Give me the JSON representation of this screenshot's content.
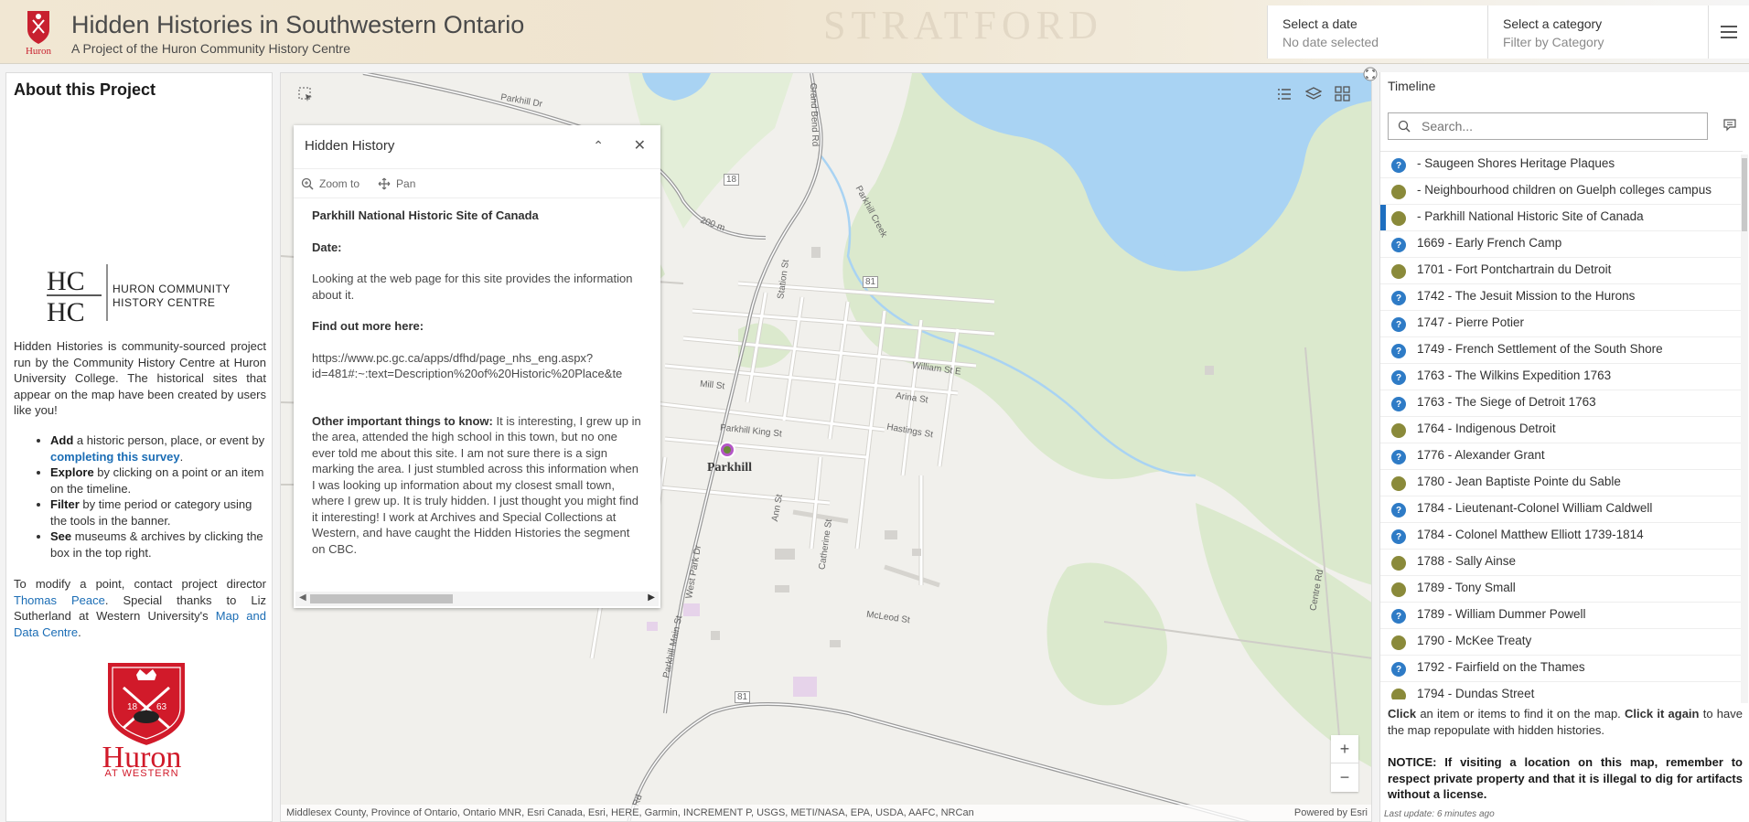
{
  "header": {
    "title": "Hidden Histories in Southwestern Ontario",
    "subtitle": "A Project of the Huron Community History Centre",
    "logo_text": "Huron",
    "date_filter": {
      "label": "Select a date",
      "value": "No date selected"
    },
    "category_filter": {
      "label": "Select a category",
      "value": "Filter by Category"
    }
  },
  "about": {
    "title": "About this Project",
    "hchc_mark": "HC",
    "hchc_name_line1": "HURON COMMUNITY",
    "hchc_name_line2": "HISTORY CENTRE",
    "intro": "Hidden Histories is community-sourced project run by the Community History Centre at Huron University College. The historical sites that appear on the map have been created by users like you!",
    "bullets": [
      {
        "strong": "Add",
        "pre": " a historic person, place, or event by ",
        "link": "completing this survey",
        "post": "."
      },
      {
        "strong": "Explore",
        "pre": " by clicking on a point or an item on the timeline.",
        "link": "",
        "post": ""
      },
      {
        "strong": "Filter",
        "pre": " by time period or category using the tools in the banner.",
        "link": "",
        "post": ""
      },
      {
        "strong": "See",
        "pre": " museums & archives by clicking the box in the top right.",
        "link": "",
        "post": ""
      }
    ],
    "modify_pre": "To modify a point, contact project director ",
    "modify_link1": "Thomas Peace",
    "modify_mid": ". Special thanks to Liz Sutherland at Western University's ",
    "modify_link2": "Map and Data Centre",
    "modify_post": ".",
    "huron_word": "Huron",
    "huron_sub": "AT WESTERN",
    "crest_left": "18",
    "crest_right": "63"
  },
  "map": {
    "town": "Parkhill",
    "streets": [
      "Parkhill Dr",
      "Mill St",
      "Parkhill King St",
      "Station St",
      "William St E",
      "Arina St",
      "Hastings St",
      "Ann St",
      "Catherine St",
      "McLeod St",
      "West Park Dr",
      "Parkhill Main St",
      "Centre Rd",
      "Grand Bend Rd",
      "Parkhill Creek",
      "200 m",
      "18",
      "81",
      "81",
      "Rd"
    ],
    "attribution": "Middlesex County, Province of Ontario, Ontario MNR, Esri Canada, Esri, HERE, Garmin, INCREMENT P, USGS, METI/NASA, EPA, USDA, AAFC, NRCan",
    "powered_by": "Powered by Esri",
    "zoom_in": "+",
    "zoom_out": "−",
    "colors": {
      "water": "#a9d3f3",
      "park": "#d7e9c6",
      "road": "#9a9a9a"
    }
  },
  "popup": {
    "title": "Hidden History",
    "zoom_label": "Zoom to",
    "pan_label": "Pan",
    "site_name": "Parkhill National Historic Site of Canada",
    "date_label": "Date:",
    "description": "Looking at the web page for this site provides the information about it.",
    "more_label": "Find out more here:",
    "url_line1": "https://www.pc.gc.ca/apps/dfhd/page_nhs_eng.aspx?",
    "url_line2": "id=481#:~:text=Description%20of%20Historic%20Place&te",
    "other_label": "Other important things to know:",
    "other_text": " It is interesting, I grew up in the area, attended the high school in this town, but no one ever told me about this site. I am not sure there is a sign marking the area. I just stumbled across this information when I was looking up information about my closest small town, where I grew up. It is truly hidden. I just thought you might find it interesting! I work at Archives and Special Collections at Western, and have caught the Hidden Histories the segment on CBC."
  },
  "timeline": {
    "title": "Timeline",
    "search_placeholder": "Search...",
    "items": [
      {
        "label": " - Saugeen Shores Heritage Plaques",
        "icon": "q"
      },
      {
        "label": " - Neighbourhood children on Guelph colleges campus",
        "icon": "p"
      },
      {
        "label": " - Parkhill National Historic Site of Canada",
        "icon": "p",
        "selected": true
      },
      {
        "label": "1669 - Early French Camp",
        "icon": "q"
      },
      {
        "label": "1701 - Fort Pontchartrain du Detroit",
        "icon": "p"
      },
      {
        "label": "1742 - The Jesuit Mission to the Hurons",
        "icon": "q"
      },
      {
        "label": "1747 - Pierre Potier",
        "icon": "q"
      },
      {
        "label": "1749 - French Settlement of the South Shore",
        "icon": "q"
      },
      {
        "label": "1763 - The Wilkins Expedition 1763",
        "icon": "q"
      },
      {
        "label": "1763 - The Siege of Detroit 1763",
        "icon": "q"
      },
      {
        "label": "1764 - Indigenous Detroit",
        "icon": "p"
      },
      {
        "label": "1776 - Alexander Grant",
        "icon": "q"
      },
      {
        "label": "1780 - Jean Baptiste Pointe du Sable",
        "icon": "p"
      },
      {
        "label": "1784 - Lieutenant-Colonel William Caldwell",
        "icon": "q"
      },
      {
        "label": "1784 - Colonel Matthew Elliott 1739-1814",
        "icon": "q"
      },
      {
        "label": "1788 - Sally Ainse",
        "icon": "p"
      },
      {
        "label": "1789 - Tony Small",
        "icon": "p"
      },
      {
        "label": "1789 - William Dummer Powell",
        "icon": "q"
      },
      {
        "label": "1790 - McKee Treaty",
        "icon": "p"
      },
      {
        "label": "1792 - Fairfield on the Thames",
        "icon": "q"
      },
      {
        "label": "1794 - Dundas Street",
        "icon": "p"
      }
    ],
    "instr_b1": "Click",
    "instr_t1": " an item or items to find it on the map. ",
    "instr_b2": "Click it again",
    "instr_t2": " to have the map repopulate with hidden histories.",
    "notice": "NOTICE: If visiting a location on this map, remember to respect private property and that it is illegal to dig for artifacts without a license.",
    "last_update": "Last update: 6 minutes ago"
  }
}
